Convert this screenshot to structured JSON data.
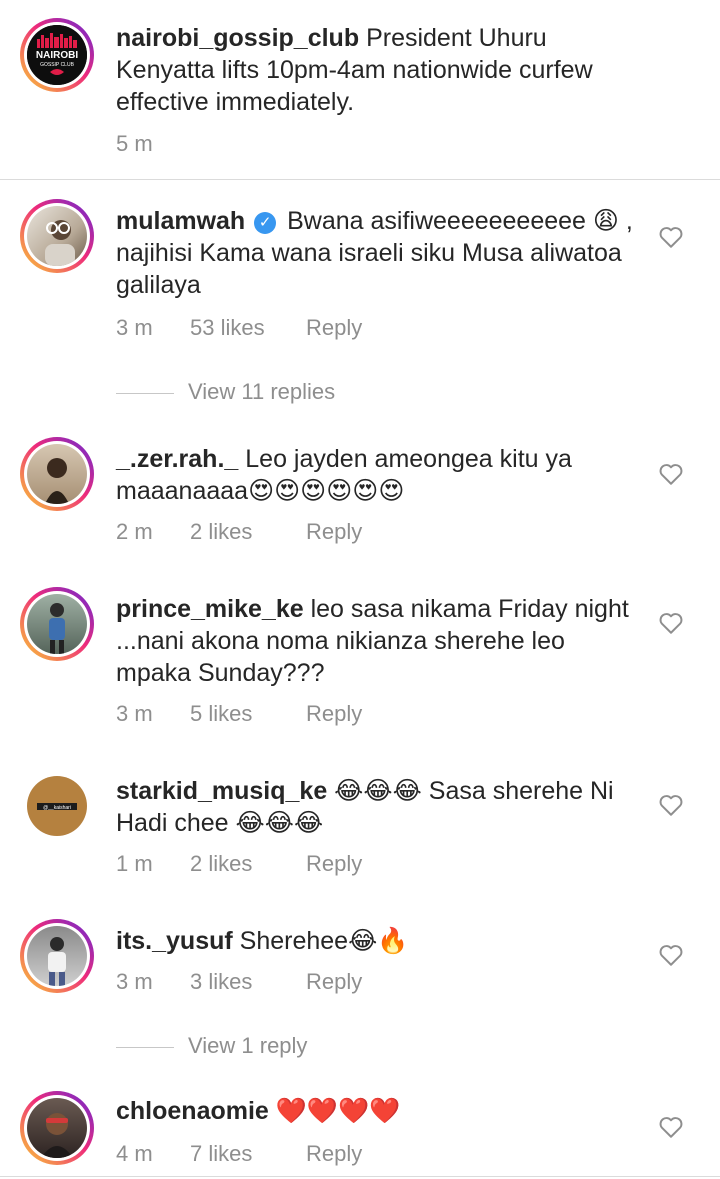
{
  "caption": {
    "username": "nairobi_gossip_club",
    "text": "President Uhuru Kenyatta lifts 10pm-4am nationwide curfew effective immediately.",
    "time": "5 m",
    "logo_line1": "NAIROBI",
    "logo_line2": "GOSSIP CLUB"
  },
  "comments": [
    {
      "username": "mulamwah",
      "verified": true,
      "text_part1": "Bwana asifiweeeeeeeeeee",
      "text_part2": ", najihisi Kama wana israeli siku Musa aliwatoa galilaya",
      "emoji_inline": "😩",
      "time": "3 m",
      "likes": "53 likes",
      "reply": "Reply",
      "view_replies": "View 11 replies"
    },
    {
      "username": "_.zer.rah._",
      "text": "Leo jayden ameongea kitu ya maaanaaaa",
      "emoji_trail": "😍😍😍😍😍😍",
      "time": "2 m",
      "likes": "2 likes",
      "reply": "Reply"
    },
    {
      "username": "prince_mike_ke",
      "text": "leo sasa nikama Friday night ...nani akona noma nikianza sherehe leo mpaka Sunday???",
      "time": "3 m",
      "likes": "5 likes",
      "reply": "Reply"
    },
    {
      "username": "starkid_musiq_ke",
      "emoji_lead": "😂😂😂",
      "text": "Sasa sherehe Ni Hadi chee",
      "emoji_trail": "😂😂😂",
      "avatar_text": "@__kaishari",
      "time": "1 m",
      "likes": "2 likes",
      "reply": "Reply"
    },
    {
      "username": "its._yusuf",
      "text": "Sherehee",
      "emoji_trail": "😂🔥",
      "time": "3 m",
      "likes": "3 likes",
      "reply": "Reply",
      "view_replies": "View 1 reply"
    },
    {
      "username": "chloenaomie",
      "emoji_trail": "❤️❤️❤️❤️",
      "time": "4 m",
      "likes": "7 likes",
      "reply": "Reply"
    }
  ],
  "icons": {
    "like": "heart-outline-icon",
    "verified": "verified-badge-icon"
  },
  "colors": {
    "text": "#262626",
    "meta": "#8e8e8e",
    "verified": "#3897f0",
    "divider": "#dbdbdb"
  }
}
